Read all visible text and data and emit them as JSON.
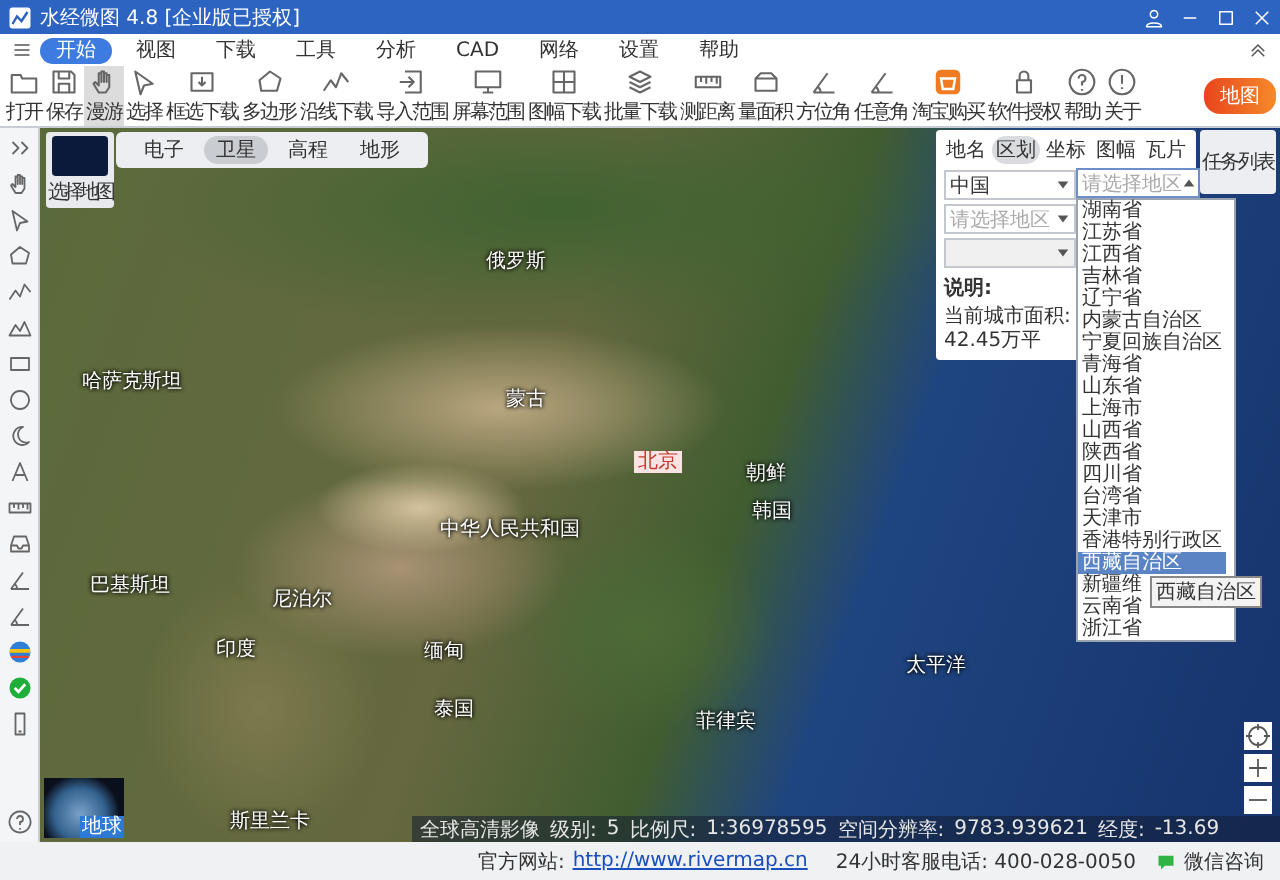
{
  "window": {
    "title": "水经微图 4.8 [企业版已授权]"
  },
  "menu": [
    {
      "label": "开始",
      "selected": true
    },
    {
      "label": "视图",
      "selected": false
    },
    {
      "label": "下载",
      "selected": false
    },
    {
      "label": "工具",
      "selected": false
    },
    {
      "label": "分析",
      "selected": false
    },
    {
      "label": "CAD",
      "selected": false
    },
    {
      "label": "网络",
      "selected": false
    },
    {
      "label": "设置",
      "selected": false
    },
    {
      "label": "帮助",
      "selected": false
    }
  ],
  "toolbar": [
    {
      "label": "打开",
      "selected": false
    },
    {
      "label": "保存",
      "selected": false
    },
    {
      "label": "漫游",
      "selected": true
    },
    {
      "label": "选择",
      "selected": false
    },
    {
      "label": "框选下载",
      "selected": false
    },
    {
      "label": "多边形",
      "selected": false
    },
    {
      "label": "沿线下载",
      "selected": false
    },
    {
      "label": "导入范围",
      "selected": false
    },
    {
      "label": "屏幕范围",
      "selected": false
    },
    {
      "label": "图幅下载",
      "selected": false
    },
    {
      "label": "批量下载",
      "selected": false
    },
    {
      "label": "测距离",
      "selected": false
    },
    {
      "label": "量面积",
      "selected": false
    },
    {
      "label": "方位角",
      "selected": false
    },
    {
      "label": "任意角",
      "selected": false
    },
    {
      "label": "淘宝购买",
      "selected": false
    },
    {
      "label": "软件授权",
      "selected": false
    },
    {
      "label": "帮助",
      "selected": false
    },
    {
      "label": "关于",
      "selected": false
    }
  ],
  "promo_button": "地图",
  "map_picker": "选择地图",
  "map_types": [
    {
      "label": "电子",
      "selected": false
    },
    {
      "label": "卫星",
      "selected": true
    },
    {
      "label": "高程",
      "selected": false
    },
    {
      "label": "地形",
      "selected": false
    }
  ],
  "map_labels": [
    {
      "text": "俄罗斯",
      "kind": "country"
    },
    {
      "text": "蒙古",
      "kind": "country"
    },
    {
      "text": "中华人民共和国",
      "kind": "country"
    },
    {
      "text": "哈萨克斯坦",
      "kind": "country"
    },
    {
      "text": "印度",
      "kind": "country"
    },
    {
      "text": "朝鲜",
      "kind": "country"
    },
    {
      "text": "韩国",
      "kind": "country"
    },
    {
      "text": "缅甸",
      "kind": "country"
    },
    {
      "text": "泰国",
      "kind": "country"
    },
    {
      "text": "菲律宾",
      "kind": "country"
    },
    {
      "text": "太平洋",
      "kind": "country"
    },
    {
      "text": "斯里兰卡",
      "kind": "country"
    },
    {
      "text": "巴基斯坦",
      "kind": "country"
    },
    {
      "text": "尼泊尔",
      "kind": "country"
    },
    {
      "text": "北京",
      "kind": "capital"
    }
  ],
  "globe_label": "地球",
  "region_panel": {
    "tabs": [
      {
        "label": "地名",
        "selected": false
      },
      {
        "label": "区划",
        "selected": true
      },
      {
        "label": "坐标",
        "selected": false
      },
      {
        "label": "图幅",
        "selected": false
      },
      {
        "label": "瓦片",
        "selected": false
      }
    ],
    "country": "中国",
    "province_placeholder": "请选择地区",
    "city_placeholder": "请选择地区",
    "note_title": "说明:",
    "note": "当前城市面积: 42.45万平",
    "options": [
      {
        "label": "湖南省",
        "selected": false
      },
      {
        "label": "江苏省",
        "selected": false
      },
      {
        "label": "江西省",
        "selected": false
      },
      {
        "label": "吉林省",
        "selected": false
      },
      {
        "label": "辽宁省",
        "selected": false
      },
      {
        "label": "内蒙古自治区",
        "selected": false
      },
      {
        "label": "宁夏回族自治区",
        "selected": false
      },
      {
        "label": "青海省",
        "selected": false
      },
      {
        "label": "山东省",
        "selected": false
      },
      {
        "label": "上海市",
        "selected": false
      },
      {
        "label": "山西省",
        "selected": false
      },
      {
        "label": "陕西省",
        "selected": false
      },
      {
        "label": "四川省",
        "selected": false
      },
      {
        "label": "台湾省",
        "selected": false
      },
      {
        "label": "天津市",
        "selected": false
      },
      {
        "label": "香港特别行政区",
        "selected": false
      },
      {
        "label": "西藏自治区",
        "selected": true
      },
      {
        "label": "新疆维",
        "selected": false
      },
      {
        "label": "云南省",
        "selected": false
      },
      {
        "label": "浙江省",
        "selected": false
      }
    ],
    "tooltip": "西藏自治区"
  },
  "task_list_button": "任务列表",
  "status_bar": [
    "全球高清影像",
    "级别:",
    "5",
    "比例尺:",
    "1:36978595",
    "空间分辨率:",
    "9783.939621",
    "经度:",
    "-13.69"
  ],
  "footer": {
    "site_label": "官方网站:",
    "site_url": "http://www.rivermap.cn",
    "phone": "24小时客服电话: 400-028-0050",
    "wechat": "微信咨询"
  }
}
